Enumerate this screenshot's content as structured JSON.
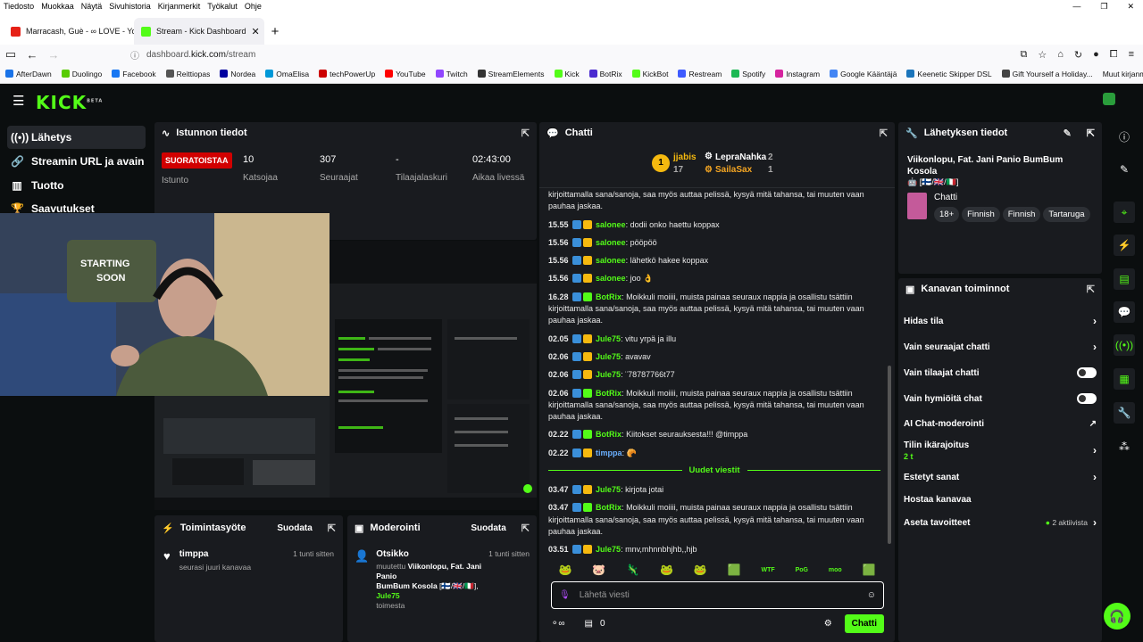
{
  "browser": {
    "menu": [
      "Tiedosto",
      "Muokkaa",
      "Näytä",
      "Sivuhistoria",
      "Kirjanmerkit",
      "Työkalut",
      "Ohje"
    ],
    "tabs": [
      {
        "title": "Marracash, Guè - ∞ LOVE - You",
        "color": "#e62117"
      },
      {
        "title": "Stream - Kick Dashboard",
        "color": "#53fc18"
      }
    ],
    "url_prefix": "dashboard.",
    "url_domain": "kick.com",
    "url_path": "/stream",
    "bookmarks": [
      [
        "AfterDawn",
        "#1a73e8"
      ],
      [
        "Duolingo",
        "#58cc02"
      ],
      [
        "Facebook",
        "#1877f2"
      ],
      [
        "Reittiopas",
        "#555"
      ],
      [
        "Nordea",
        "#0000a0"
      ],
      [
        "OmaElisa",
        "#0098d8"
      ],
      [
        "techPowerUp",
        "#c00"
      ],
      [
        "YouTube",
        "#f00"
      ],
      [
        "Twitch",
        "#9146ff"
      ],
      [
        "StreamElements",
        "#333"
      ],
      [
        "Kick",
        "#53fc18"
      ],
      [
        "BotRix",
        "#4b2bd0"
      ],
      [
        "KickBot",
        "#53fc18"
      ],
      [
        "Restream",
        "#3e5bff"
      ],
      [
        "Spotify",
        "#1db954"
      ],
      [
        "Instagram",
        "#d6249f"
      ],
      [
        "Google Kääntäjä",
        "#4285f4"
      ],
      [
        "Keenetic Skipper DSL",
        "#1b75bb"
      ],
      [
        "Gift Yourself a Holiday...",
        "#444"
      ]
    ],
    "more": "Muut kirjanmerkit"
  },
  "kick": {
    "logo": "KICK",
    "beta": "BETA"
  },
  "nav": [
    "Lähetys",
    "Streamin URL ja avain",
    "Tuotto",
    "Saavutukset"
  ],
  "session": {
    "title": "Istunnon tiedot",
    "live": "SUORATOISTAA",
    "live_label": "Istunto",
    "viewers": "10",
    "viewers_label": "Katsojaa",
    "followers": "307",
    "followers_label": "Seuraajat",
    "subs": "-",
    "subs_label": "Tilaajalaskuri",
    "time": "02:43:00",
    "time_label": "Aikaa livessä"
  },
  "activity": {
    "title": "Toimintasyöte",
    "filter": "Suodata",
    "user": "timppa",
    "text": "seurasi juuri kanavaa",
    "time": "1 tunti sitten"
  },
  "moderation": {
    "title": "Moderointi",
    "filter": "Suodata",
    "heading": "Otsikko",
    "time": "1 tunti sitten",
    "line1": "muutettu",
    "line1b": "Viikonlopu, Fat. Jani Panio",
    "line2": "BumBum Kosola",
    "flags": "[🇫🇮/🇬🇧/🇮🇹]",
    "user": "Jule75",
    "line3": "toimesta"
  },
  "chat": {
    "title": "Chatti",
    "top": [
      {
        "rank": "1",
        "name": "jjabis",
        "count": "17"
      },
      {
        "name": "LepraNahka",
        "count": "2"
      },
      {
        "name": "SailaSax",
        "count": "1"
      }
    ],
    "messages": [
      {
        "t": "",
        "u": "",
        "text": "kirjoittamalla sana/sanoja, saa myös auttaa pelissä, kysyä mitä tahansa, tai muuten vaan pauhaa jaskaa.",
        "c": "#fff"
      },
      {
        "t": "15.55",
        "u": "salonee",
        "text": "dodii onko haettu koppax",
        "c": "#53fc18"
      },
      {
        "t": "15.56",
        "u": "salonee",
        "text": "pööpöö",
        "c": "#53fc18"
      },
      {
        "t": "15.56",
        "u": "salonee",
        "text": "lähetkö hakee koppax",
        "c": "#53fc18"
      },
      {
        "t": "15.56",
        "u": "salonee",
        "text": "joo 👌",
        "c": "#53fc18"
      },
      {
        "t": "16.28",
        "u": "BotRix",
        "text": "Moikkuli moiiii, muista painaa seuraux nappia ja osallistu tsättiin kirjoittamalla sana/sanoja, saa myös auttaa pelissä, kysyä mitä tahansa, tai muuten vaan pauhaa jaskaa.",
        "c": "#53fc18"
      },
      {
        "t": "02.05",
        "u": "Jule75",
        "text": "vitu yrpä ja illu",
        "c": "#53fc18"
      },
      {
        "t": "02.06",
        "u": "Jule75",
        "text": "avavav",
        "c": "#53fc18"
      },
      {
        "t": "02.06",
        "u": "Jule75",
        "text": "¨78787766t77",
        "c": "#53fc18"
      },
      {
        "t": "02.06",
        "u": "BotRix",
        "text": "Moikkuli moiiii, muista painaa seuraux nappia ja osallistu tsättiin kirjoittamalla sana/sanoja, saa myös auttaa pelissä, kysyä mitä tahansa, tai muuten vaan pauhaa jaskaa.",
        "c": "#53fc18"
      },
      {
        "t": "02.22",
        "u": "BotRix",
        "text": "Kiitokset seurauksesta!!! @timppa",
        "c": "#53fc18"
      },
      {
        "t": "02.22",
        "u": "timppa",
        "text": "🥐",
        "c": "#6ab0ff"
      }
    ],
    "new_label": "Uudet viestit",
    "messages2": [
      {
        "t": "03.47",
        "u": "Jule75",
        "text": "kirjota jotai",
        "c": "#53fc18"
      },
      {
        "t": "03.47",
        "u": "BotRix",
        "text": "Moikkuli moiiii, muista painaa seuraux nappia ja osallistu tsättiin kirjoittamalla sana/sanoja, saa myös auttaa pelissä, kysyä mitä tahansa, tai muuten vaan pauhaa jaskaa.",
        "c": "#53fc18"
      },
      {
        "t": "03.51",
        "u": "Jule75",
        "text": "mnv,mhnnbhjhb,,hjb",
        "c": "#53fc18"
      }
    ],
    "emotes": [
      "🐸",
      "🐷",
      "🦎",
      "🐸",
      "🐸",
      "🟩",
      "WTF",
      "PoG",
      "moo",
      "🟩"
    ],
    "placeholder": "Lähetä viesti",
    "count": "0",
    "send": "Chatti"
  },
  "streaminfo": {
    "title": "Lähetyksen tiedot",
    "stream_title": "Viikonlopu, Fat. Jani Panio BumBum Kosola",
    "flags": "🤖 [🇫🇮/🇬🇧/🇮🇹]",
    "category": "Chatti",
    "tags": [
      "18+",
      "Finnish",
      "Finnish",
      "Tartaruga"
    ]
  },
  "channel": {
    "title": "Kanavan toiminnot",
    "rows": [
      "Hidas tila",
      "Vain seuraajat chatti",
      "Vain tilaajat chatti",
      "Vain hymiöitä chat",
      "AI Chat-moderointi",
      "Tilin ikärajoitus",
      "Estetyt sanat",
      "Hostaa kanavaa",
      "Aseta tavoitteet"
    ],
    "age_value": "2 t",
    "goals_status": "2 aktiivista"
  }
}
